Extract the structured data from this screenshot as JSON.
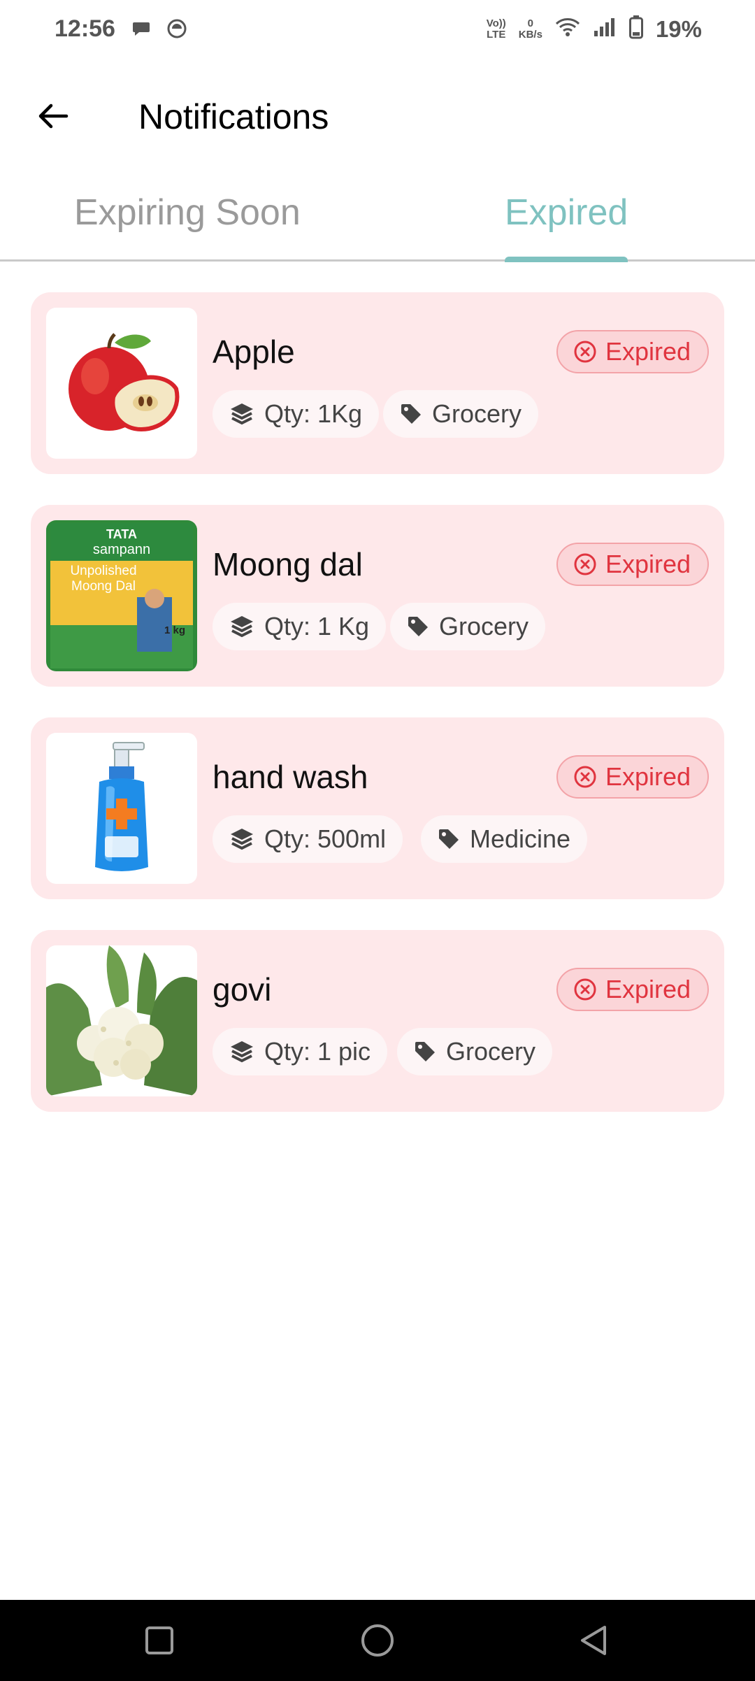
{
  "status_bar": {
    "time": "12:56",
    "volte_top": "Vo))",
    "volte_bottom": "LTE",
    "speed_value": "0",
    "speed_unit": "KB/s",
    "battery": "19%",
    "icons": [
      "message-icon",
      "android-head-icon",
      "wifi-icon",
      "signal-icon",
      "battery-icon"
    ]
  },
  "app_bar": {
    "title": "Notifications",
    "back_icon": "arrow-left-icon"
  },
  "tabs": [
    {
      "label": "Expiring Soon",
      "active": false
    },
    {
      "label": "Expired",
      "active": true
    }
  ],
  "colors": {
    "accent": "#7fc2c0",
    "card_bg": "#fee8ea",
    "badge_text": "#e0343f",
    "badge_bg": "#fbd5d8"
  },
  "items": [
    {
      "name": "Apple",
      "status": "Expired",
      "qty": "Qty: 1Kg",
      "category": "Grocery",
      "image": "apple"
    },
    {
      "name": "Moong dal",
      "status": "Expired",
      "qty": "Qty: 1 Kg",
      "category": "Grocery",
      "image": "moong-dal-packet",
      "image_text": {
        "brand_top": "TATA",
        "brand": "sampann",
        "line1": "Unpolished",
        "line2": "Moong Dal",
        "weight": "1 kg"
      }
    },
    {
      "name": "hand wash",
      "status": "Expired",
      "qty": "Qty: 500ml",
      "category": "Medicine",
      "image": "hand-wash-bottle"
    },
    {
      "name": "govi",
      "status": "Expired",
      "qty": "Qty: 1 pic",
      "category": "Grocery",
      "image": "cauliflower"
    }
  ],
  "nav_bar": {
    "icons": [
      "recents-icon",
      "home-icon",
      "back-triangle-icon"
    ]
  }
}
